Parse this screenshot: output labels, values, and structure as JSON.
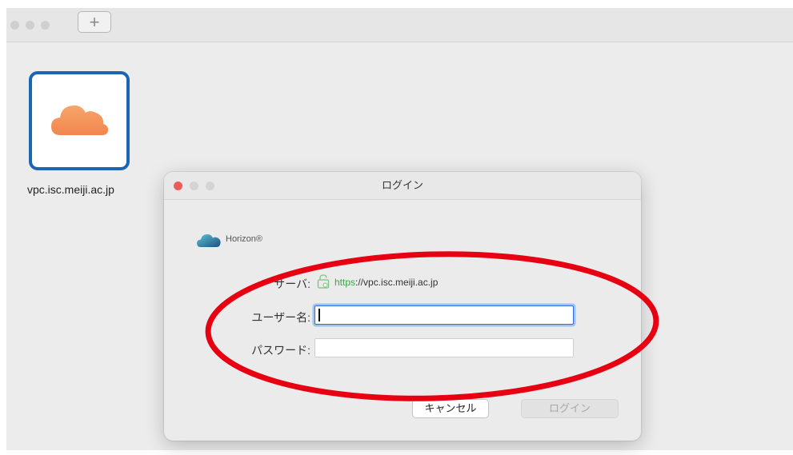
{
  "toolbar": {
    "add_label": "+"
  },
  "servers": [
    {
      "name": "vpc.isc.meiji.ac.jp"
    }
  ],
  "login_dialog": {
    "title": "ログイン",
    "brand": "Horizon®",
    "server_label": "サーバ:",
    "server_url_scheme": "https",
    "server_url_rest": "://vpc.isc.meiji.ac.jp",
    "username_label": "ユーザー名:",
    "username_value": "",
    "password_label": "パスワード:",
    "password_value": "",
    "cancel_label": "キャンセル",
    "login_label": "ログイン"
  },
  "colors": {
    "accent": "#1b66b3",
    "close_red": "#ee5b57",
    "cloud_orange": "#f4935a",
    "highlight_red": "#e60012",
    "https_green": "#2fae3b",
    "focus_blue": "#2f72d7"
  },
  "icons": {
    "server_tile": "cloud-icon",
    "brand": "horizon-logo-icon",
    "secure": "lock-icon"
  }
}
